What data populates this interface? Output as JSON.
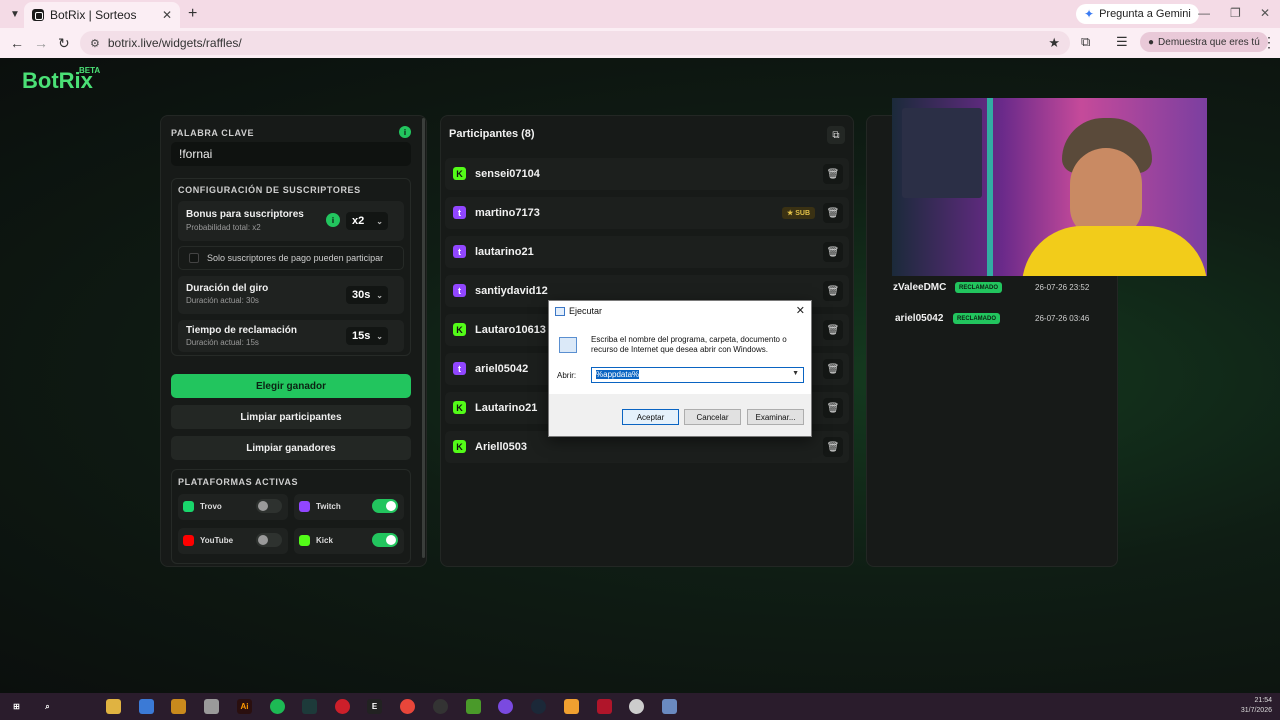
{
  "browser": {
    "tab_title": "BotRix | Sorteos",
    "url": "botrix.live/widgets/raffles/",
    "gemini_label": "Pregunta a Gemini",
    "profile_label": "Demuestra que eres tú"
  },
  "logo": {
    "name": "BotRix",
    "badge": "BETA"
  },
  "left": {
    "keyword_label": "PALABRA CLAVE",
    "keyword_value": "!fornai",
    "subs_label": "CONFIGURACIÓN DE SUSCRIPTORES",
    "bonus_title": "Bonus para suscriptores",
    "bonus_sub": "Probabilidad total: x2",
    "bonus_value": "x2",
    "only_subs_label": "Solo suscriptores de pago pueden participar",
    "spin_title": "Duración del giro",
    "spin_sub": "Duración actual: 30s",
    "spin_value": "30s",
    "claim_title": "Tiempo de reclamación",
    "claim_sub": "Duración actual: 15s",
    "claim_value": "15s",
    "btn_pick": "Elegir ganador",
    "btn_clear_participants": "Limpiar participantes",
    "btn_clear_winners": "Limpiar ganadores",
    "platforms_label": "PLATAFORMAS ACTIVAS",
    "platforms": [
      {
        "name": "Trovo",
        "enabled": false,
        "color": "#19d66b"
      },
      {
        "name": "Twitch",
        "enabled": true,
        "color": "#9146ff"
      },
      {
        "name": "YouTube",
        "enabled": false,
        "color": "#ff0000"
      },
      {
        "name": "Kick",
        "enabled": true,
        "color": "#53fc18"
      }
    ]
  },
  "participants": {
    "title": "Participantes (8)",
    "sub_badge": "SUB",
    "items": [
      {
        "name": "sensei07104",
        "platform": "kick"
      },
      {
        "name": "martino7173",
        "platform": "twitch",
        "sub": true
      },
      {
        "name": "lautarino21",
        "platform": "twitch"
      },
      {
        "name": "santiydavid12",
        "platform": "twitch"
      },
      {
        "name": "Lautaro10613",
        "platform": "kick"
      },
      {
        "name": "ariel05042",
        "platform": "twitch"
      },
      {
        "name": "Lautarino21",
        "platform": "kick"
      },
      {
        "name": "Ariell0503",
        "platform": "kick"
      }
    ]
  },
  "winners": {
    "claimed_label": "RECLAMADO",
    "items": [
      {
        "name": "zValeeDMC",
        "date": "26-07-26 23:52"
      },
      {
        "name": "ariel05042",
        "date": "26-07-26 03:46"
      }
    ]
  },
  "run_dialog": {
    "title": "Ejecutar",
    "description": "Escriba el nombre del programa, carpeta, documento o recurso de Internet que desea abrir con Windows.",
    "open_label": "Abrir:",
    "input_value": "%appdata%",
    "ok": "Aceptar",
    "cancel": "Cancelar",
    "browse": "Examinar..."
  },
  "taskbar": {
    "time": "21:54",
    "date": "31/7/2026"
  }
}
